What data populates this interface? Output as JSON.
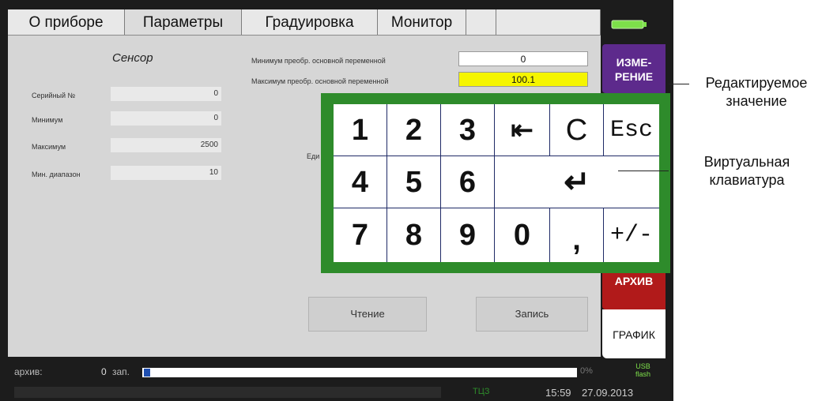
{
  "tabs": [
    "О приборе",
    "Параметры",
    "Градуировка",
    "Монитор",
    "",
    ""
  ],
  "sensor": {
    "title": "Сенсор",
    "fields": [
      {
        "label": "Серийный №",
        "value": "0"
      },
      {
        "label": "Минимум",
        "value": "0"
      },
      {
        "label": "Максимум",
        "value": "2500"
      },
      {
        "label": "Мин. диапазон",
        "value": "10"
      }
    ]
  },
  "conversion": {
    "min_label": "Минимум преобр. основной переменной",
    "min_value": "0",
    "max_label": "Максимум преобр. основной переменной",
    "max_value": "100.1",
    "unit_label": "Еди"
  },
  "buttons": {
    "read": "Чтение",
    "write": "Запись"
  },
  "side": {
    "measure": "ИЗМЕ-\nРЕНИЕ",
    "archive": "АРХИВ",
    "graph": "ГРАФИК"
  },
  "keypad": {
    "row1": [
      "1",
      "2",
      "3",
      "⇤",
      "C",
      "Esc"
    ],
    "row2": [
      "4",
      "5",
      "6",
      "↵"
    ],
    "row3": [
      "7",
      "8",
      "9",
      "0",
      ",",
      "+/-"
    ]
  },
  "status": {
    "archive_label": "архив:",
    "archive_count": "0",
    "archive_unit": "зап.",
    "percent": "0%",
    "usb": "USB\nflash",
    "mode": "ТЦЗ",
    "time": "15:59",
    "date": "27.09.2013"
  },
  "callouts": {
    "edited_value": "Редактируемое\nзначение",
    "virtual_keyboard": "Виртуальная\nклавиатура"
  },
  "colors": {
    "keypad_green": "#2e8b2b",
    "highlight_yellow": "#f5f500",
    "measure_purple": "#5d2a8c",
    "archive_red": "#b11a1a",
    "battery_green": "#7de04a"
  }
}
